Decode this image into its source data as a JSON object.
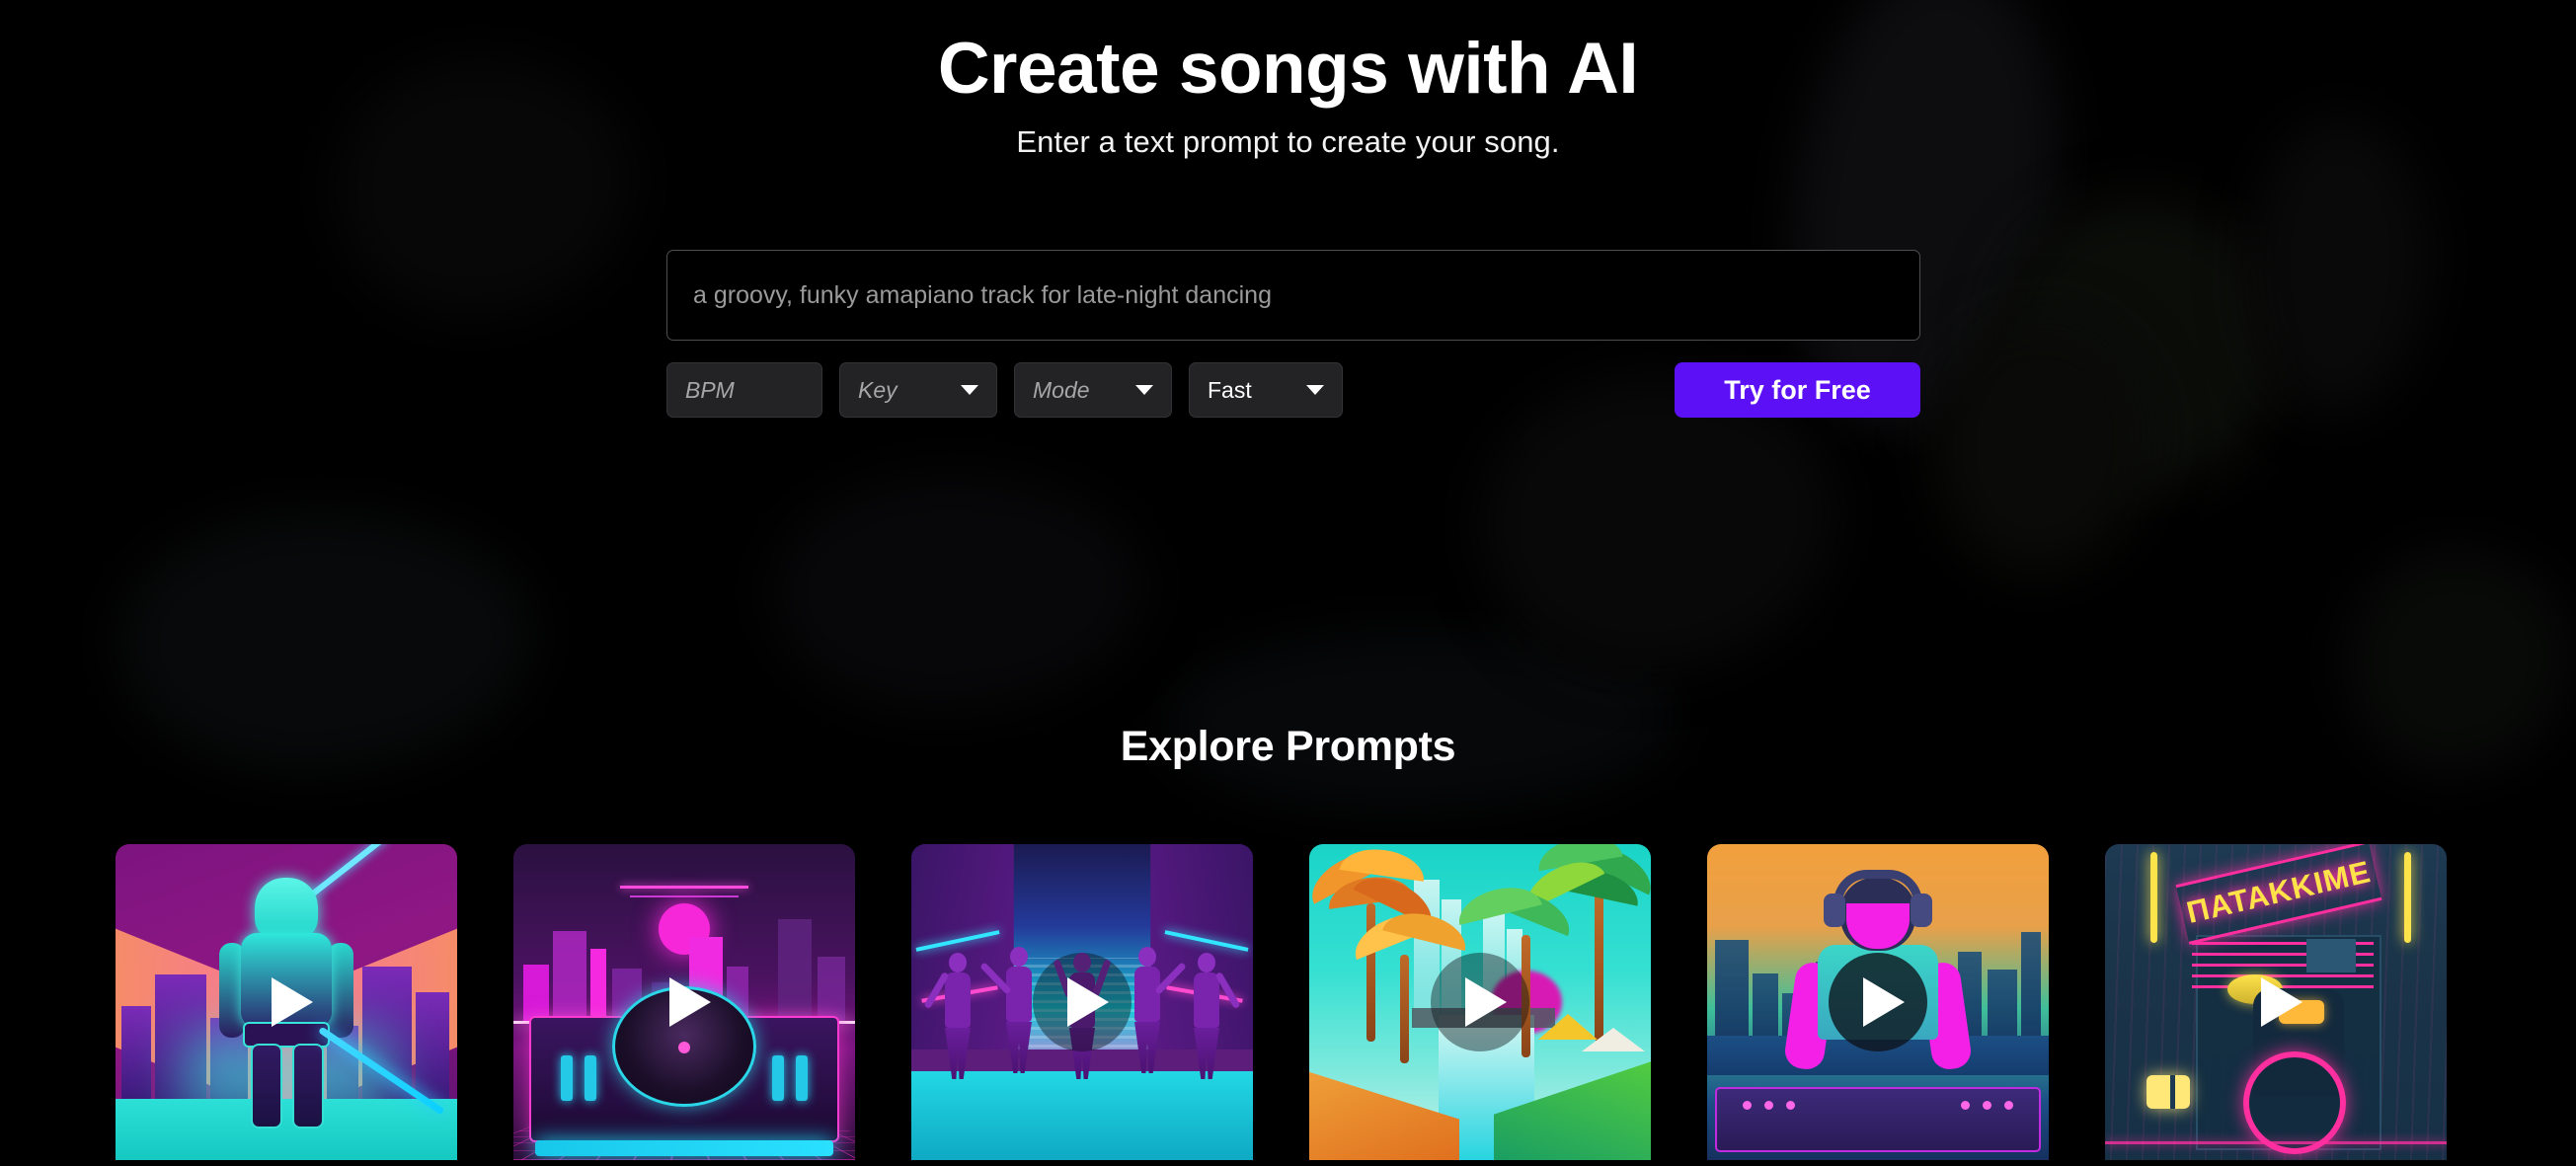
{
  "hero": {
    "title": "Create songs with AI",
    "subtitle": "Enter a text prompt to create your song."
  },
  "prompt_form": {
    "input_placeholder": "a groovy, funky amapiano track for late-night dancing",
    "input_value": "",
    "controls": [
      {
        "name": "bpm",
        "label": "BPM",
        "is_placeholder": true,
        "has_caret": false
      },
      {
        "name": "key",
        "label": "Key",
        "is_placeholder": true,
        "has_caret": true
      },
      {
        "name": "mode",
        "label": "Mode",
        "is_placeholder": true,
        "has_caret": true
      },
      {
        "name": "speed",
        "label": "Fast",
        "is_placeholder": false,
        "has_caret": true
      }
    ],
    "submit_label": "Try for Free"
  },
  "explore": {
    "title": "Explore Prompts",
    "cards": [
      {
        "id": "card-1",
        "art": "neon-knight-cyberpunk-city",
        "play_style": "plain"
      },
      {
        "id": "card-2",
        "art": "synthwave-turntable-skyline",
        "play_style": "plain"
      },
      {
        "id": "card-3",
        "art": "neon-dancers-street",
        "play_style": "dim"
      },
      {
        "id": "card-4",
        "art": "tropical-canal-palms",
        "play_style": "dim"
      },
      {
        "id": "card-5",
        "art": "dj-headphones-mixer-sunset",
        "play_style": "solid"
      },
      {
        "id": "card-6",
        "art": "neon-venue-drummer",
        "play_style": "plain",
        "sign_text": "ΠΑΤΑΚΚΙΜΕ"
      }
    ]
  },
  "colors": {
    "background": "#000000",
    "accent_purple": "#5b10f5",
    "input_border": "#4e4e50",
    "control_fill": "#232326",
    "placeholder_text": "#9a9a9a",
    "title_text": "#ffffff"
  }
}
